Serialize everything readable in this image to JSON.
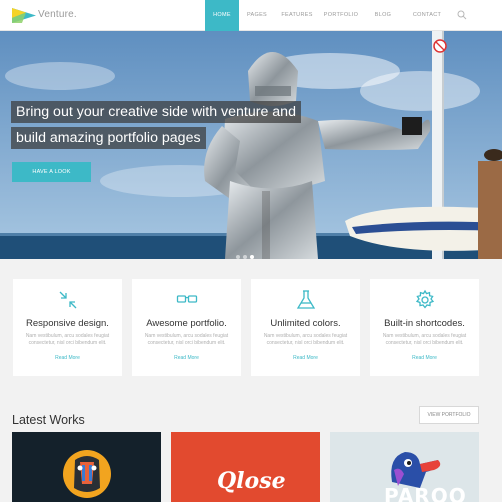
{
  "brand": {
    "name": "Venture."
  },
  "nav": {
    "items": [
      {
        "label": "HOME",
        "active": true
      },
      {
        "label": "PAGES",
        "active": false
      },
      {
        "label": "FEATURES",
        "active": false
      },
      {
        "label": "PORTFOLIO",
        "active": false
      },
      {
        "label": "BLOG",
        "active": false
      },
      {
        "label": "CONTACT",
        "active": false
      }
    ],
    "search_icon": "search-icon"
  },
  "hero": {
    "headline_1": "Bring out your creative side with venture and",
    "headline_2": "build amazing portfolio pages",
    "cta_label": "HAVE A LOOK",
    "slides_total": 3,
    "active_slide": 3
  },
  "features": [
    {
      "icon": "arrows-collapse-icon",
      "title": "Responsive design.",
      "desc": "Nam vestibulum, arcu sodales feugiat consectetur, nisl orci bibendum elit.",
      "link": "Read More"
    },
    {
      "icon": "glasses-icon",
      "title": "Awesome portfolio.",
      "desc": "Nam vestibulum, arcu sodales feugiat consectetur, nisl orci bibendum elit.",
      "link": "Read More"
    },
    {
      "icon": "flask-icon",
      "title": "Unlimited colors.",
      "desc": "Nam vestibulum, arcu sodales feugiat consectetur, nisl orci bibendum elit.",
      "link": "Read More"
    },
    {
      "icon": "gear-icon",
      "title": "Built-in shortcodes.",
      "desc": "Nam vestibulum, arcu sodales feugiat consectetur, nisl orci bibendum elit.",
      "link": "Read More"
    }
  ],
  "works": {
    "title": "Latest Works",
    "view_label": "VIEW PORTFOLIO",
    "items": [
      {
        "art": "mandrill-logo"
      },
      {
        "text": "Qlose"
      },
      {
        "text": "PAROO"
      }
    ]
  },
  "colors": {
    "accent": "#3db9c7",
    "dark": "#14212b",
    "orange": "#e24a2f"
  }
}
